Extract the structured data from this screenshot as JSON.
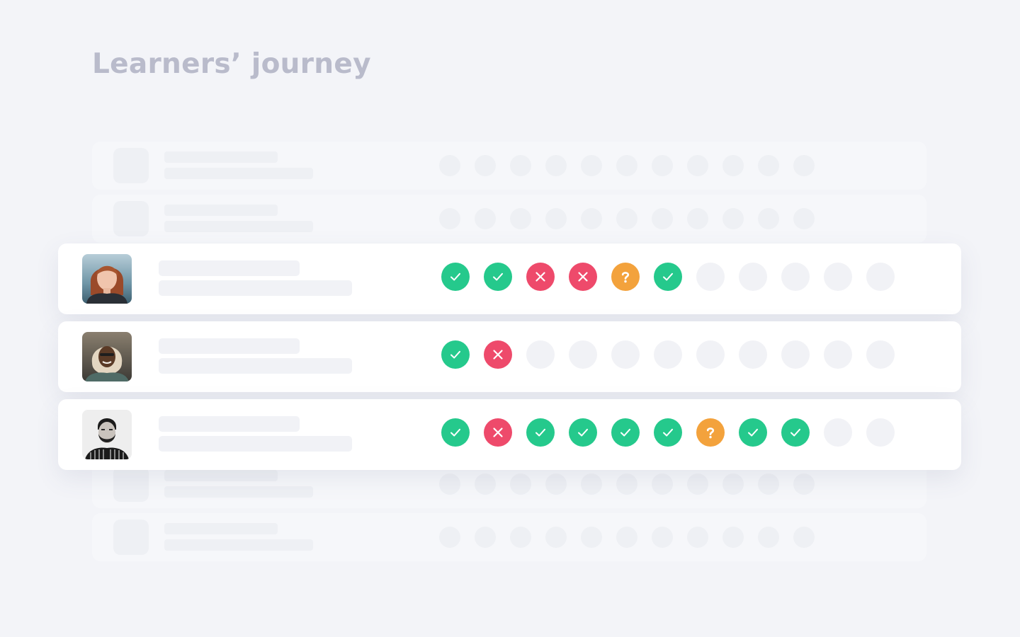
{
  "page": {
    "title": "Learners’ journey"
  },
  "colors": {
    "background": "#f3f4f8",
    "title": "#b9bbcb",
    "passed": "#25c98c",
    "failed": "#ee4a6b",
    "unknown": "#f3a23c",
    "pending": "#f1f2f6"
  },
  "status_icons": {
    "passed": "check-icon",
    "failed": "cross-icon",
    "unknown": "question-icon",
    "pending": "empty-circle"
  },
  "learners": [
    {
      "avatar": "woman-red-hair-avatar",
      "steps": [
        "passed",
        "passed",
        "failed",
        "failed",
        "unknown",
        "passed",
        "pending",
        "pending",
        "pending",
        "pending",
        "pending"
      ]
    },
    {
      "avatar": "woman-headscarf-avatar",
      "steps": [
        "passed",
        "failed",
        "pending",
        "pending",
        "pending",
        "pending",
        "pending",
        "pending",
        "pending",
        "pending",
        "pending"
      ]
    },
    {
      "avatar": "bearded-man-avatar",
      "steps": [
        "passed",
        "failed",
        "passed",
        "passed",
        "passed",
        "passed",
        "unknown",
        "passed",
        "passed",
        "pending",
        "pending"
      ]
    }
  ]
}
